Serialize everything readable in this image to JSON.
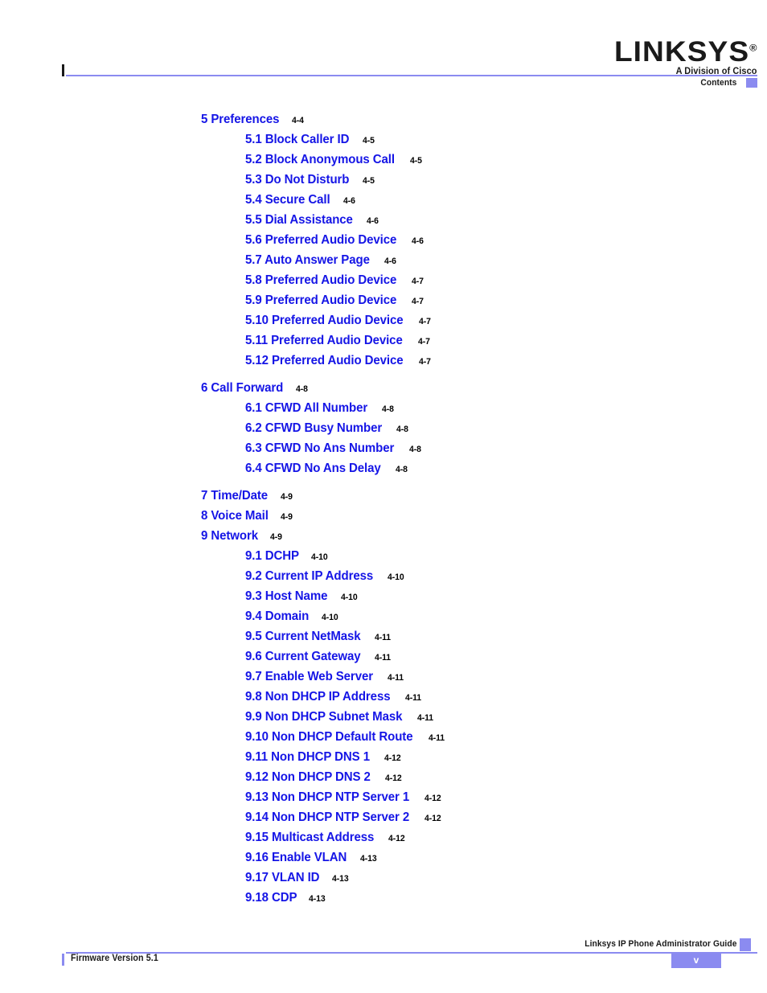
{
  "header": {
    "logo_wordmark": "LINKSYS",
    "logo_registered": "®",
    "logo_tagline": "A Division of Cisco",
    "chapter_name": "Contents",
    "accent_color": "#8b8bf0"
  },
  "toc": {
    "link_color": "#1515e6",
    "page_color": "#000000",
    "entries": [
      {
        "level": 1,
        "title": "5 Preferences",
        "page": "4-4",
        "gap_before": false
      },
      {
        "level": 2,
        "title": "5.1 Block Caller ID",
        "page": "4-5",
        "gap_before": false
      },
      {
        "level": 2,
        "title": "5.2 Block Anonymous Call",
        "page": "4-5",
        "gap_before": false
      },
      {
        "level": 2,
        "title": "5.3 Do Not Disturb",
        "page": "4-5",
        "gap_before": false
      },
      {
        "level": 2,
        "title": "5.4 Secure Call",
        "page": "4-6",
        "gap_before": false
      },
      {
        "level": 2,
        "title": "5.5 Dial Assistance",
        "page": "4-6",
        "gap_before": false
      },
      {
        "level": 2,
        "title": "5.6 Preferred Audio Device",
        "page": "4-6",
        "gap_before": false
      },
      {
        "level": 2,
        "title": "5.7 Auto Answer Page",
        "page": "4-6",
        "gap_before": false
      },
      {
        "level": 2,
        "title": "5.8 Preferred Audio Device",
        "page": "4-7",
        "gap_before": false
      },
      {
        "level": 2,
        "title": "5.9 Preferred Audio Device",
        "page": "4-7",
        "gap_before": false
      },
      {
        "level": 2,
        "title": "5.10 Preferred Audio Device",
        "page": "4-7",
        "gap_before": false
      },
      {
        "level": 2,
        "title": "5.11 Preferred Audio Device",
        "page": "4-7",
        "gap_before": false
      },
      {
        "level": 2,
        "title": "5.12 Preferred Audio Device",
        "page": "4-7",
        "gap_before": false
      },
      {
        "level": 1,
        "title": "6 Call Forward",
        "page": "4-8",
        "gap_before": true
      },
      {
        "level": 2,
        "title": "6.1 CFWD All Number",
        "page": "4-8",
        "gap_before": false
      },
      {
        "level": 2,
        "title": "6.2 CFWD Busy Number",
        "page": "4-8",
        "gap_before": false
      },
      {
        "level": 2,
        "title": "6.3 CFWD No Ans Number",
        "page": "4-8",
        "gap_before": false
      },
      {
        "level": 2,
        "title": "6.4 CFWD No Ans Delay",
        "page": "4-8",
        "gap_before": false
      },
      {
        "level": 1,
        "title": "7 Time/Date",
        "page": "4-9",
        "gap_before": true
      },
      {
        "level": 1,
        "title": "8 Voice Mail",
        "page": "4-9",
        "gap_before": false
      },
      {
        "level": 1,
        "title": "9 Network",
        "page": "4-9",
        "gap_before": false
      },
      {
        "level": 2,
        "title": "9.1 DCHP",
        "page": "4-10",
        "gap_before": false
      },
      {
        "level": 2,
        "title": "9.2 Current IP Address",
        "page": "4-10",
        "gap_before": false
      },
      {
        "level": 2,
        "title": "9.3 Host Name",
        "page": "4-10",
        "gap_before": false
      },
      {
        "level": 2,
        "title": "9.4 Domain",
        "page": "4-10",
        "gap_before": false
      },
      {
        "level": 2,
        "title": "9.5 Current NetMask",
        "page": "4-11",
        "gap_before": false
      },
      {
        "level": 2,
        "title": "9.6 Current Gateway",
        "page": "4-11",
        "gap_before": false
      },
      {
        "level": 2,
        "title": "9.7 Enable Web Server",
        "page": "4-11",
        "gap_before": false
      },
      {
        "level": 2,
        "title": "9.8 Non DHCP IP Address",
        "page": "4-11",
        "gap_before": false
      },
      {
        "level": 2,
        "title": "9.9 Non DHCP Subnet Mask",
        "page": "4-11",
        "gap_before": false
      },
      {
        "level": 2,
        "title": "9.10 Non DHCP Default Route",
        "page": "4-11",
        "gap_before": false
      },
      {
        "level": 2,
        "title": "9.11 Non DHCP DNS 1",
        "page": "4-12",
        "gap_before": false
      },
      {
        "level": 2,
        "title": "9.12 Non DHCP DNS 2",
        "page": "4-12",
        "gap_before": false
      },
      {
        "level": 2,
        "title": "9.13 Non DHCP NTP Server 1",
        "page": "4-12",
        "gap_before": false
      },
      {
        "level": 2,
        "title": "9.14 Non DHCP NTP Server 2",
        "page": "4-12",
        "gap_before": false
      },
      {
        "level": 2,
        "title": "9.15 Multicast Address",
        "page": "4-12",
        "gap_before": false
      },
      {
        "level": 2,
        "title": "9.16 Enable VLAN",
        "page": "4-13",
        "gap_before": false
      },
      {
        "level": 2,
        "title": "9.17 VLAN ID",
        "page": "4-13",
        "gap_before": false
      },
      {
        "level": 2,
        "title": "9.18 CDP",
        "page": "4-13",
        "gap_before": false
      }
    ]
  },
  "footer": {
    "guide_title": "Linksys IP Phone Administrator Guide",
    "firmware": "Firmware Version 5.1",
    "page_number": "v"
  }
}
